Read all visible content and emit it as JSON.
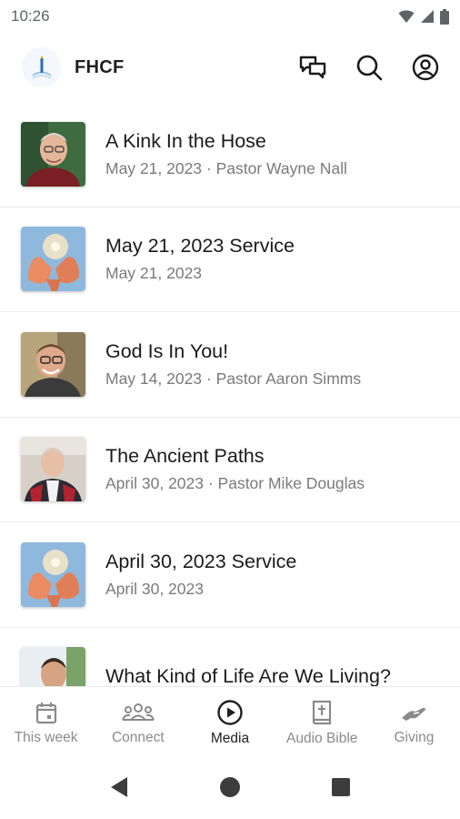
{
  "status_bar": {
    "time": "10:26"
  },
  "app_bar": {
    "title": "FHCF"
  },
  "media_items": [
    {
      "title": "A Kink In the Hose",
      "subtitle": "May 21, 2023 · Pastor Wayne Nall",
      "thumb": "man-glasses-red-shirt-photo"
    },
    {
      "title": "May 21, 2023 Service",
      "subtitle": "May 21, 2023",
      "thumb": "open-hands-light-photo"
    },
    {
      "title": "God Is In You!",
      "subtitle": "May 14, 2023 · Pastor Aaron Simms",
      "thumb": "smiling-man-glasses-photo"
    },
    {
      "title": "The Ancient Paths",
      "subtitle": "April 30, 2023 · Pastor Mike Douglas",
      "thumb": "man-preaching-photo"
    },
    {
      "title": "April 30, 2023 Service",
      "subtitle": "April 30, 2023",
      "thumb": "open-hands-light-photo"
    },
    {
      "title": "What Kind of Life Are We Living?",
      "subtitle": "",
      "thumb": "man-portrait-photo"
    }
  ],
  "bottom_nav": [
    {
      "label": "This week",
      "icon": "calendar-icon",
      "active": false
    },
    {
      "label": "Connect",
      "icon": "group-icon",
      "active": false
    },
    {
      "label": "Media",
      "icon": "play-circle-icon",
      "active": true
    },
    {
      "label": "Audio Bible",
      "icon": "bible-icon",
      "active": false
    },
    {
      "label": "Giving",
      "icon": "giving-hand-icon",
      "active": false
    }
  ],
  "colors": {
    "active_nav": "#1f1f1f",
    "inactive_nav": "#8a8a8a",
    "subtitle": "#7a7a7a",
    "divider": "#ececec"
  }
}
